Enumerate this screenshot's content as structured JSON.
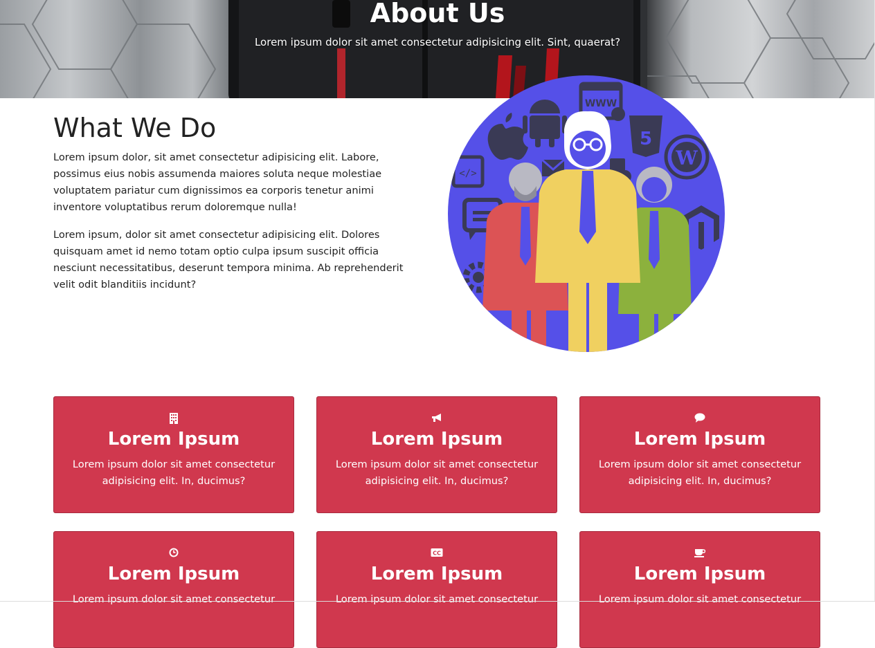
{
  "hero": {
    "title": "About Us",
    "subtitle": "Lorem ipsum dolor sit amet consectetur adipisicing elit. Sint, quaerat?"
  },
  "what_we_do": {
    "title": "What We Do",
    "paragraphs": [
      "Lorem ipsum dolor, sit amet consectetur adipisicing elit. Labore, possimus eius nobis assumenda maiores soluta neque molestiae voluptatem pariatur cum dignissimos ea corporis tenetur animi inventore voluptatibus rerum doloremque nulla!",
      "Lorem ipsum, dolor sit amet consectetur adipisicing elit. Dolores quisquam amet id nemo totam optio culpa ipsum suscipit officia nesciunt necessitatibus, deserunt tempora minima. Ab reprehenderit velit odit blanditiis incidunt?"
    ],
    "illustration_icons": [
      "android-icon",
      "apple-icon",
      "www-icon",
      "html5-icon",
      "wordpress-icon",
      "code-icon",
      "mail-icon",
      "chat-icon",
      "magento-icon",
      "gear-icon",
      "document-icon"
    ]
  },
  "colors": {
    "card_bg": "#d0384e",
    "illustration_bg": "#5550e8",
    "person_red": "#dc5355",
    "person_yellow": "#f0d060",
    "person_green": "#8cb13d"
  },
  "cards": [
    {
      "icon": "building-icon",
      "title": "Lorem Ipsum",
      "text": "Lorem ipsum dolor sit amet consectetur adipisicing elit. In, ducimus?"
    },
    {
      "icon": "megaphone-icon",
      "title": "Lorem Ipsum",
      "text": "Lorem ipsum dolor sit amet consectetur adipisicing elit. In, ducimus?"
    },
    {
      "icon": "comment-icon",
      "title": "Lorem Ipsum",
      "text": "Lorem ipsum dolor sit amet consectetur adipisicing elit. In, ducimus?"
    },
    {
      "icon": "clock-icon",
      "title": "Lorem Ipsum",
      "text": "Lorem ipsum dolor sit amet consectetur"
    },
    {
      "icon": "closed-captioning-icon",
      "title": "Lorem Ipsum",
      "text": "Lorem ipsum dolor sit amet consectetur"
    },
    {
      "icon": "coffee-icon",
      "title": "Lorem Ipsum",
      "text": "Lorem ipsum dolor sit amet consectetur"
    }
  ]
}
